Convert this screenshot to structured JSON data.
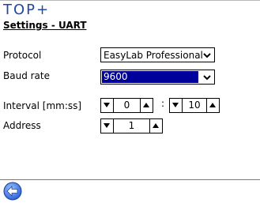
{
  "header": {
    "logo": "TOP+",
    "title": "Settings - UART"
  },
  "protocol": {
    "label": "Protocol",
    "value": "EasyLab Professional"
  },
  "baud": {
    "label": "Baud rate",
    "value": "9600"
  },
  "interval": {
    "label": "Interval [mm:ss]",
    "minutes": "0",
    "separator": ":",
    "seconds": "10"
  },
  "address": {
    "label": "Address",
    "value": "1"
  },
  "colors": {
    "accent": "#2147a6",
    "selection": "#00009a"
  }
}
